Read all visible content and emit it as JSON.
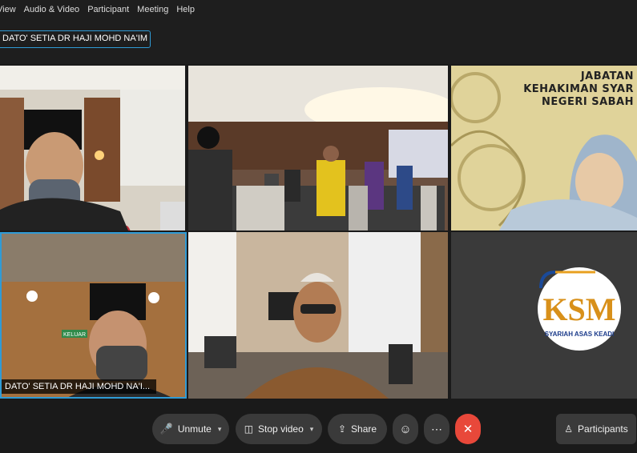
{
  "menu": [
    "View",
    "Audio & Video",
    "Participant",
    "Meeting",
    "Help"
  ],
  "active_speaker": "DATO' SETIA DR HAJI MOHD NA'IM ...",
  "tiles": {
    "self_name": "DATO' SETIA DR HAJI MOHD NA'I...",
    "jabatan_lines": [
      "JABATAN",
      "KEHAKIMAN SYAR",
      "NEGERI SABAH"
    ],
    "logo_text": "KSM",
    "logo_caption": "SYARIAH ASAS KEADI",
    "wall_sign": "KELUAR"
  },
  "controls": {
    "unmute": "Unmute",
    "stop_video": "Stop video",
    "share": "Share",
    "participants": "Participants"
  },
  "colors": {
    "accent": "#2f9bd6",
    "leave": "#e8483a",
    "mute": "#e8483a"
  }
}
